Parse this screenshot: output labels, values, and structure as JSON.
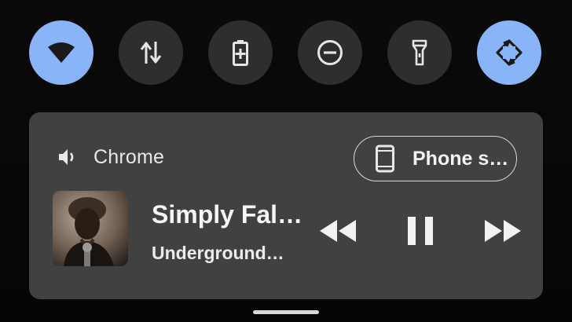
{
  "quick_settings": {
    "tiles": [
      {
        "name": "wifi-tile",
        "icon": "wifi-icon",
        "active": true
      },
      {
        "name": "mobile-data-tile",
        "icon": "data-arrows-icon",
        "active": false
      },
      {
        "name": "battery-saver-tile",
        "icon": "battery-saver-icon",
        "active": false
      },
      {
        "name": "do-not-disturb-tile",
        "icon": "do-not-disturb-icon",
        "active": false
      },
      {
        "name": "flashlight-tile",
        "icon": "flashlight-icon",
        "active": false
      },
      {
        "name": "auto-rotate-tile",
        "icon": "auto-rotate-icon",
        "active": true
      }
    ],
    "active_color": "#8ab4f8",
    "inactive_color": "#2e2e2e"
  },
  "media": {
    "app_name": "Chrome",
    "output_device": "Phone s…",
    "song_title": "Simply Fal…",
    "artist": "Underground…",
    "controls": [
      "rewind-icon",
      "pause-icon",
      "fast-forward-icon"
    ],
    "card_color": "#414141"
  }
}
